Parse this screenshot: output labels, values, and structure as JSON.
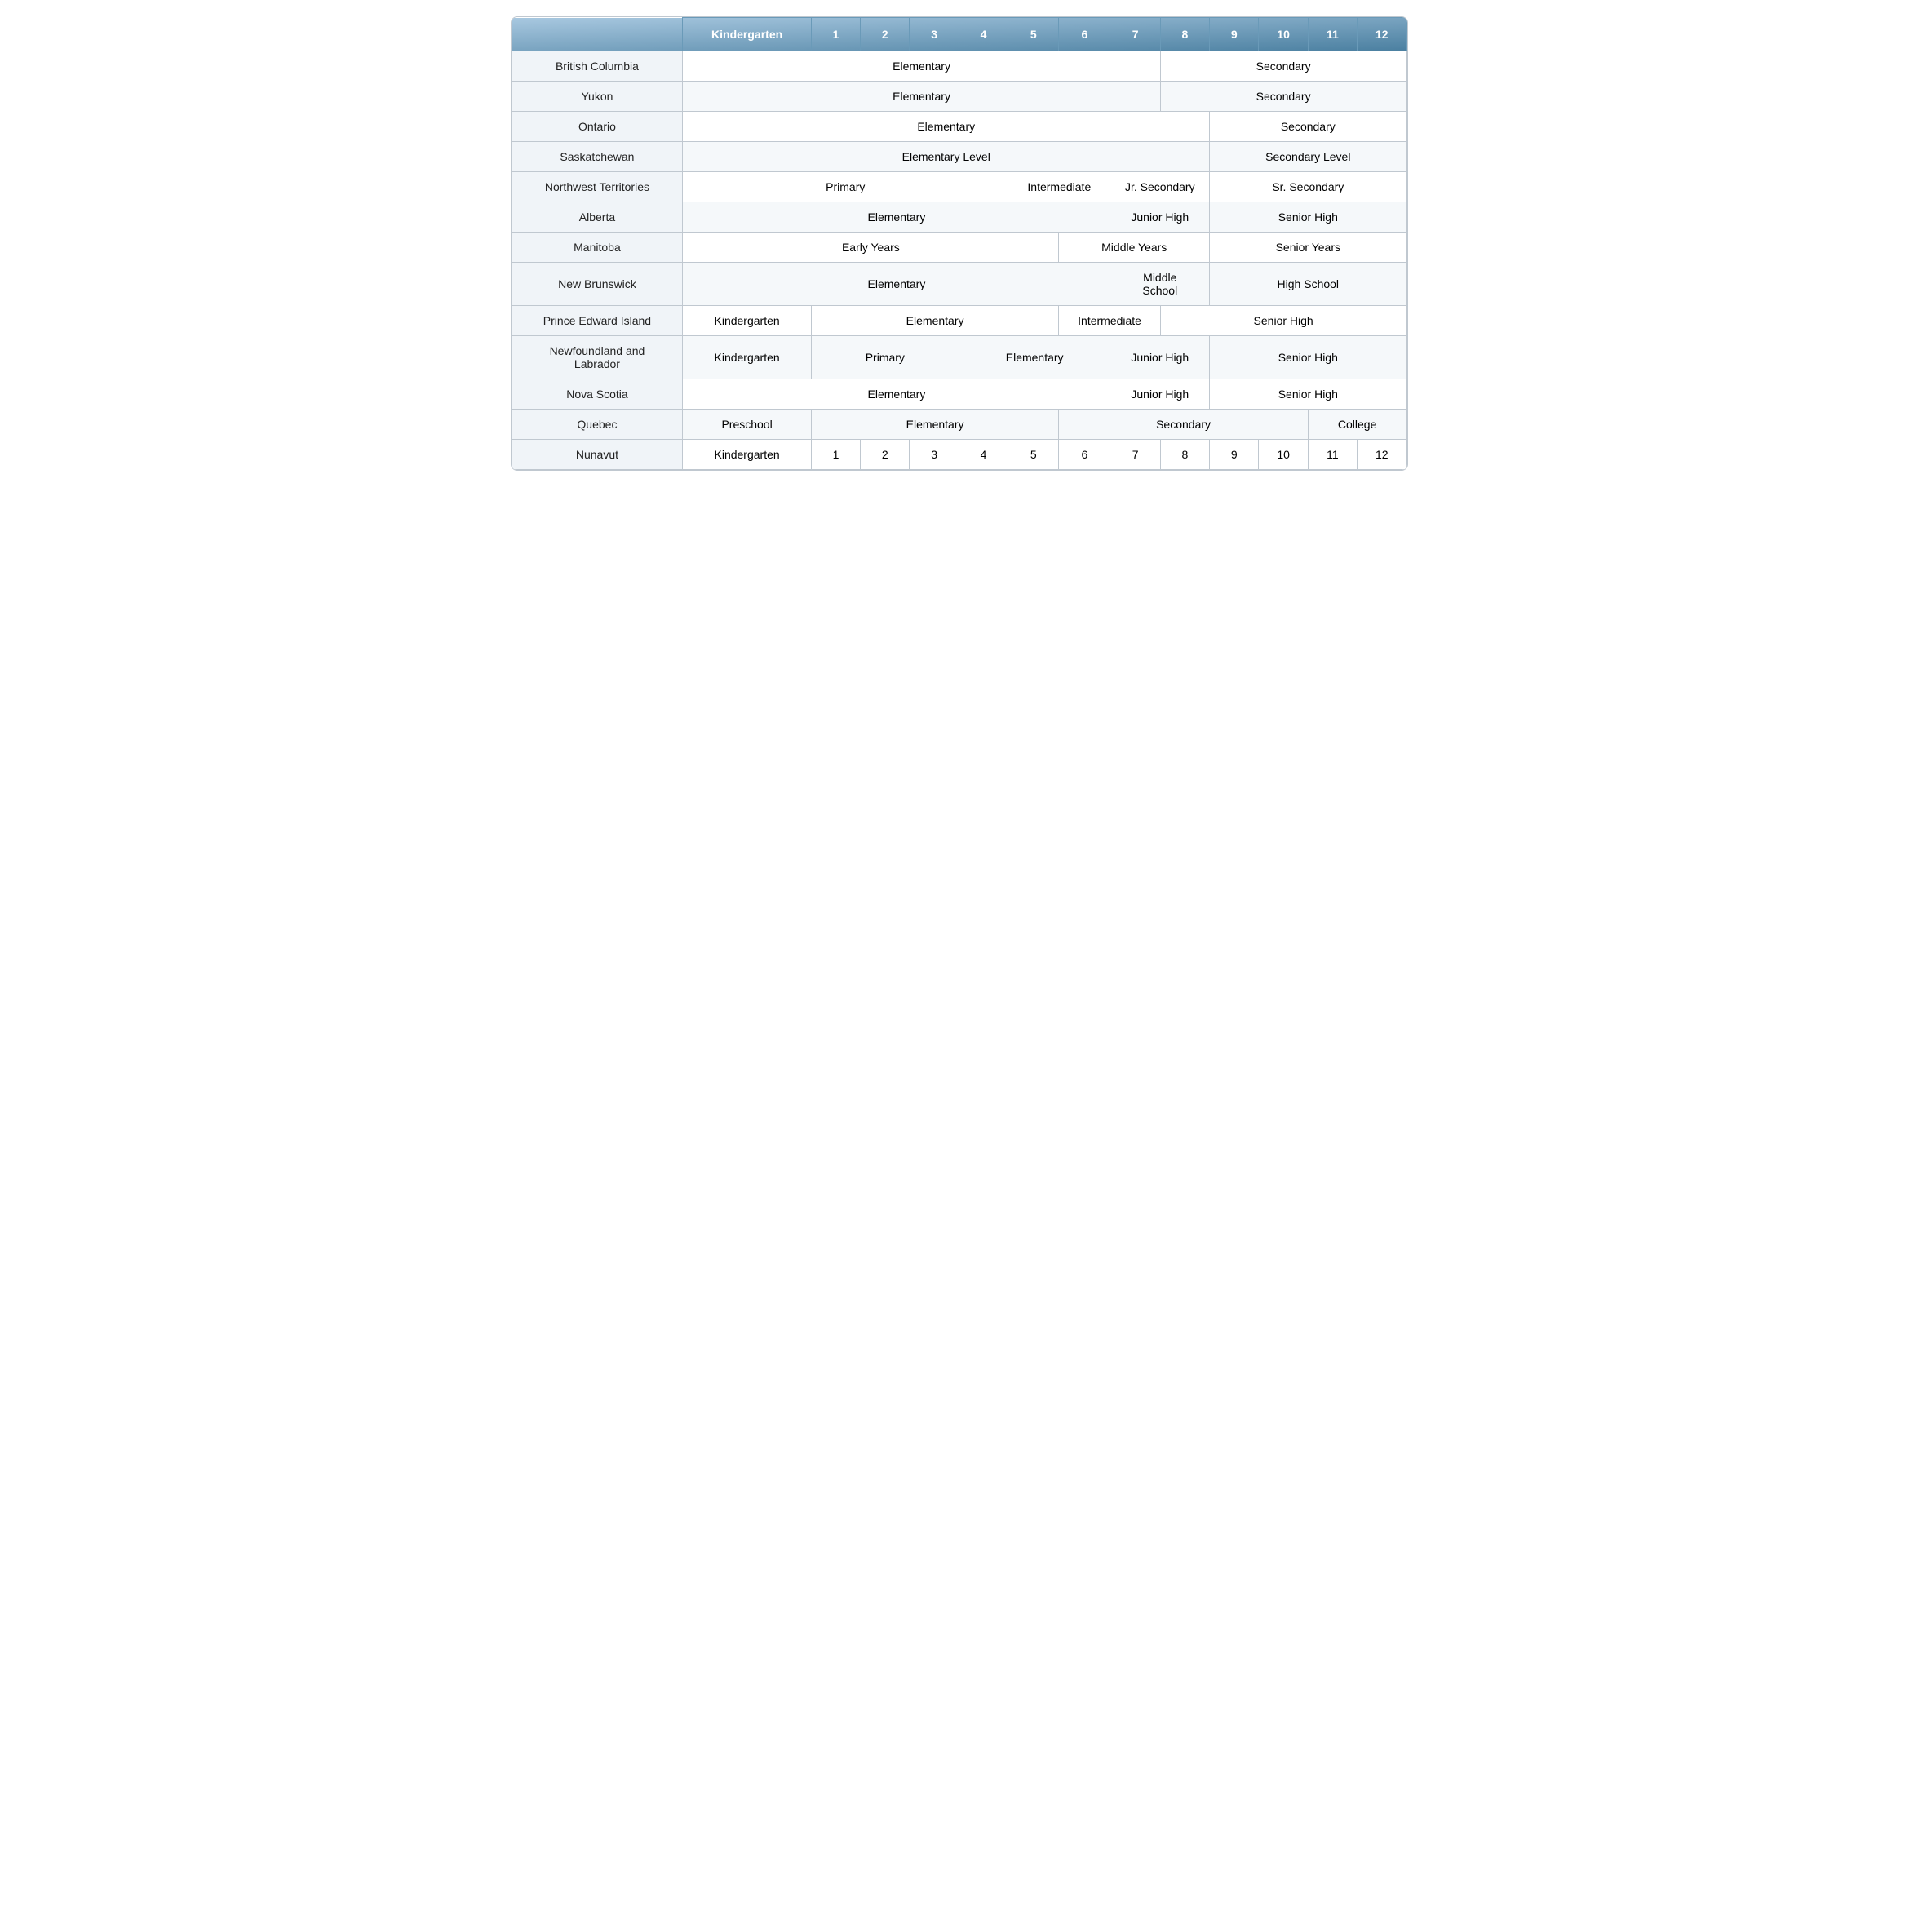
{
  "header": {
    "province_label": "",
    "kindergarten_label": "Kindergarten",
    "grades": [
      "1",
      "2",
      "3",
      "4",
      "5",
      "6",
      "7",
      "8",
      "9",
      "10",
      "11",
      "12"
    ]
  },
  "rows": [
    {
      "province": "British Columbia",
      "cells": [
        {
          "label": "Elementary",
          "span": 8,
          "type": "elementary"
        },
        {
          "label": "Secondary",
          "span": 5,
          "type": "secondary"
        }
      ]
    },
    {
      "province": "Yukon",
      "cells": [
        {
          "label": "Elementary",
          "span": 8,
          "type": "elementary"
        },
        {
          "label": "Secondary",
          "span": 5,
          "type": "secondary"
        }
      ]
    },
    {
      "province": "Ontario",
      "cells": [
        {
          "label": "Elementary",
          "span": 9,
          "type": "elementary"
        },
        {
          "label": "Secondary",
          "span": 4,
          "type": "secondary"
        }
      ]
    },
    {
      "province": "Saskatchewan",
      "cells": [
        {
          "label": "Elementary Level",
          "span": 9,
          "type": "elementary"
        },
        {
          "label": "Secondary Level",
          "span": 4,
          "type": "secondary"
        }
      ]
    },
    {
      "province": "Northwest Territories",
      "cells": [
        {
          "label": "Primary",
          "span": 5,
          "type": "primary"
        },
        {
          "label": "Intermediate",
          "span": 2,
          "type": "intermediate"
        },
        {
          "label": "Jr. Secondary",
          "span": 2,
          "type": "jr-secondary"
        },
        {
          "label": "Sr. Secondary",
          "span": 4,
          "type": "sr-secondary"
        }
      ]
    },
    {
      "province": "Alberta",
      "cells": [
        {
          "label": "Elementary",
          "span": 7,
          "type": "elementary"
        },
        {
          "label": "Junior High",
          "span": 2,
          "type": "junior-high"
        },
        {
          "label": "Senior High",
          "span": 4,
          "type": "senior-high"
        }
      ]
    },
    {
      "province": "Manitoba",
      "cells": [
        {
          "label": "Early Years",
          "span": 6,
          "type": "early-years"
        },
        {
          "label": "Middle Years",
          "span": 3,
          "type": "middle-years"
        },
        {
          "label": "Senior Years",
          "span": 4,
          "type": "senior-years"
        }
      ]
    },
    {
      "province": "New Brunswick",
      "cells": [
        {
          "label": "Elementary",
          "span": 7,
          "type": "elementary"
        },
        {
          "label": "Middle\nSchool",
          "span": 2,
          "type": "middle-school"
        },
        {
          "label": "High School",
          "span": 4,
          "type": "high-school"
        }
      ]
    },
    {
      "province": "Prince Edward Island",
      "cells": [
        {
          "label": "Kindergarten",
          "span": 1,
          "type": "kindergarten"
        },
        {
          "label": "Elementary",
          "span": 5,
          "type": "elementary"
        },
        {
          "label": "Intermediate",
          "span": 2,
          "type": "intermediate"
        },
        {
          "label": "Senior High",
          "span": 5,
          "type": "senior-high"
        }
      ]
    },
    {
      "province": "Newfoundland and\nLabrador",
      "cells": [
        {
          "label": "Kindergarten",
          "span": 1,
          "type": "kindergarten"
        },
        {
          "label": "Primary",
          "span": 3,
          "type": "primary"
        },
        {
          "label": "Elementary",
          "span": 3,
          "type": "elementary"
        },
        {
          "label": "Junior High",
          "span": 2,
          "type": "junior-high"
        },
        {
          "label": "Senior High",
          "span": 4,
          "type": "senior-high"
        }
      ]
    },
    {
      "province": "Nova Scotia",
      "cells": [
        {
          "label": "Elementary",
          "span": 7,
          "type": "elementary"
        },
        {
          "label": "Junior High",
          "span": 2,
          "type": "junior-high"
        },
        {
          "label": "Senior High",
          "span": 4,
          "type": "senior-high"
        }
      ]
    },
    {
      "province": "Quebec",
      "cells": [
        {
          "label": "Preschool",
          "span": 1,
          "type": "preschool"
        },
        {
          "label": "Elementary",
          "span": 5,
          "type": "elementary"
        },
        {
          "label": "Secondary",
          "span": 5,
          "type": "secondary"
        },
        {
          "label": "College",
          "span": 2,
          "type": "college"
        }
      ]
    },
    {
      "province": "Nunavut",
      "cells": [
        {
          "label": "Kindergarten",
          "span": 1,
          "type": "nunavut-kg"
        },
        {
          "label": "1",
          "span": 1,
          "type": "nunavut-grade"
        },
        {
          "label": "2",
          "span": 1,
          "type": "nunavut-grade"
        },
        {
          "label": "3",
          "span": 1,
          "type": "nunavut-grade"
        },
        {
          "label": "4",
          "span": 1,
          "type": "nunavut-grade"
        },
        {
          "label": "5",
          "span": 1,
          "type": "nunavut-grade"
        },
        {
          "label": "6",
          "span": 1,
          "type": "nunavut-grade"
        },
        {
          "label": "7",
          "span": 1,
          "type": "nunavut-grade"
        },
        {
          "label": "8",
          "span": 1,
          "type": "nunavut-grade"
        },
        {
          "label": "9",
          "span": 1,
          "type": "nunavut-grade"
        },
        {
          "label": "10",
          "span": 1,
          "type": "nunavut-grade"
        },
        {
          "label": "11",
          "span": 1,
          "type": "nunavut-grade"
        },
        {
          "label": "12",
          "span": 1,
          "type": "nunavut-grade"
        }
      ]
    }
  ]
}
